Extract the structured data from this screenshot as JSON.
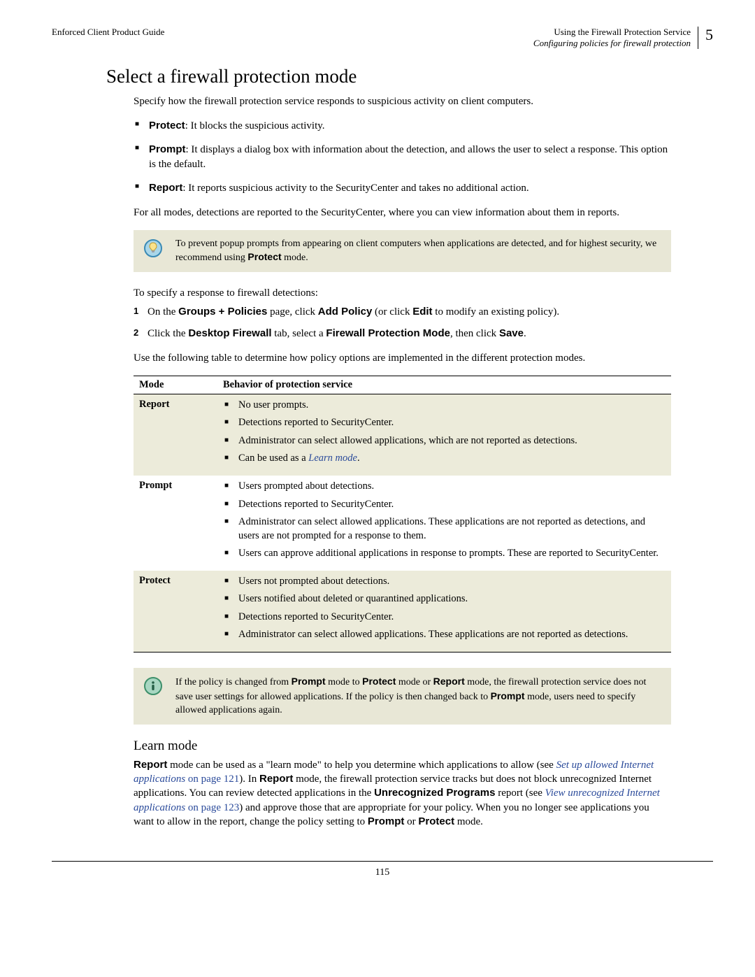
{
  "header": {
    "left": "Enforced Client Product Guide",
    "right_line1": "Using the Firewall Protection Service",
    "right_line2": "Configuring policies for firewall protection",
    "chapter_num": "5"
  },
  "section_title": "Select a firewall protection mode",
  "intro": "Specify how the firewall protection service responds to suspicious activity on client computers.",
  "modes_bullets": {
    "protect_label": "Protect",
    "protect_text": ": It blocks the suspicious activity.",
    "prompt_label": "Prompt",
    "prompt_text": ": It displays a dialog box with information about the detection, and allows the user to select a response. This option is the default.",
    "report_label": "Report",
    "report_text": ": It reports suspicious activity to the SecurityCenter and takes no additional action."
  },
  "all_modes_para": "For all modes, detections are reported to the SecurityCenter, where you can view information about them in reports.",
  "tip_note": {
    "pre": "To prevent popup prompts from appearing on client computers when applications are detected, and for highest security, we recommend using ",
    "bold": "Protect",
    "post": " mode."
  },
  "specify_lead": "To specify a response to firewall detections:",
  "steps": {
    "s1": {
      "num": "1",
      "pre": "On the ",
      "b1": "Groups + Policies",
      "mid1": " page, click ",
      "b2": "Add Policy",
      "mid2": " (or click ",
      "b3": "Edit",
      "post": " to modify an existing policy)."
    },
    "s2": {
      "num": "2",
      "pre": "Click the ",
      "b1": "Desktop Firewall",
      "mid1": " tab, select a ",
      "b2": "Firewall Protection Mode",
      "mid2": ", then click ",
      "b3": "Save",
      "post": "."
    }
  },
  "table_lead": "Use the following table to determine how policy options are implemented in the different protection modes.",
  "table": {
    "h1": "Mode",
    "h2": "Behavior of protection service",
    "rows": {
      "report": {
        "mode": "Report",
        "b1": "No user prompts.",
        "b2": "Detections reported to SecurityCenter.",
        "b3": "Administrator can select allowed applications, which are not reported as detections.",
        "b4a": "Can be used as a ",
        "b4link": "Learn mode",
        "b4b": "."
      },
      "prompt": {
        "mode": "Prompt",
        "b1": "Users prompted about detections.",
        "b2": "Detections reported to SecurityCenter.",
        "b3": "Administrator can select allowed applications. These applications are not reported as detections, and users are not prompted for a response to them.",
        "b4": "Users can approve additional applications in response to prompts. These are reported to SecurityCenter."
      },
      "protect": {
        "mode": "Protect",
        "b1": "Users not prompted about detections.",
        "b2": "Users notified about deleted or quarantined applications.",
        "b3": "Detections reported to SecurityCenter.",
        "b4": "Administrator can select allowed applications. These applications are not reported as detections."
      }
    }
  },
  "info_note": {
    "pre": "If the policy is changed from ",
    "b1": "Prompt",
    "mid1": " mode to ",
    "b2": "Protect",
    "mid2": " mode or ",
    "b3": "Report",
    "mid3": " mode, the firewall protection service does not save user settings for allowed applications. If the policy is then changed back to ",
    "b4": "Prompt",
    "post": " mode, users need to specify allowed applications again."
  },
  "learn": {
    "heading": "Learn mode",
    "p1_b1": "Report",
    "p1_t1": " mode can be used as a \"learn mode\" to help you determine which applications to allow (see ",
    "p1_link1": "Set up allowed Internet applications",
    "p1_link1_tail": " on page 121",
    "p1_t2": "). In ",
    "p1_b2": "Report",
    "p1_t3": " mode, the firewall protection service tracks but does not block unrecognized Internet applications. You can review detected applications in the ",
    "p1_b3": "Unrecognized Programs",
    "p1_t4": " report (see ",
    "p1_link2": "View unrecognized Internet applications",
    "p1_link2_tail": " on page 123",
    "p1_t5": ") and approve those that are appropriate for your policy. When you no longer see applications you want to allow in the report, change the policy setting to ",
    "p1_b4": "Prompt",
    "p1_t6": " or ",
    "p1_b5": "Protect",
    "p1_t7": " mode."
  },
  "page_number": "115"
}
